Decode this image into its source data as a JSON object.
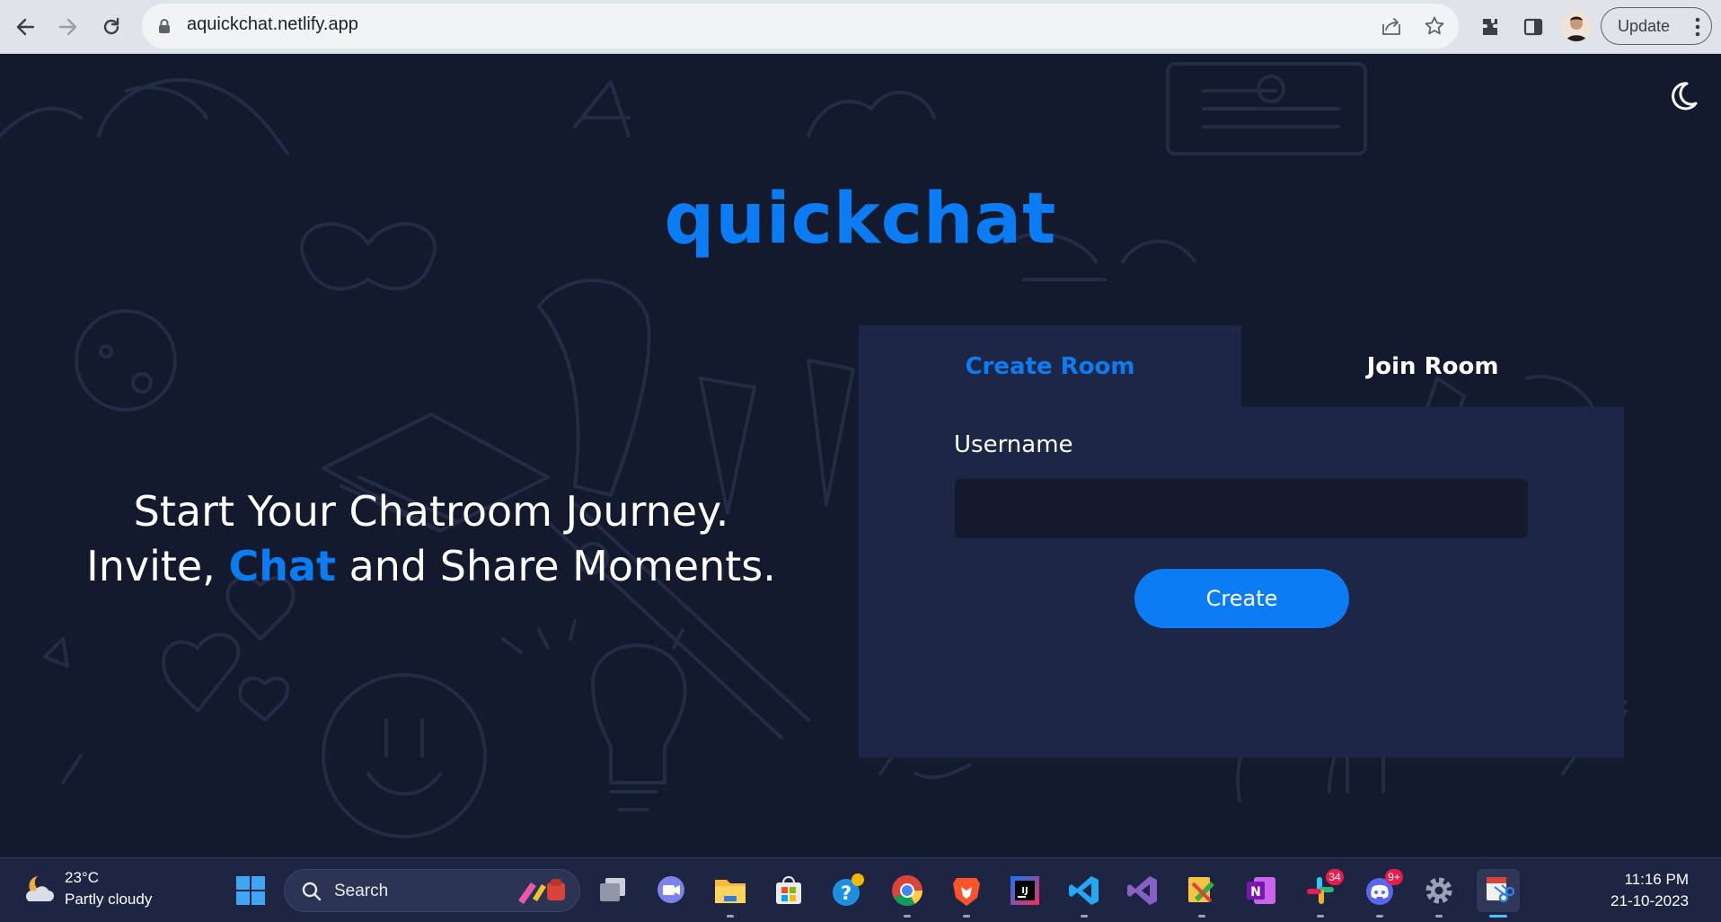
{
  "browser": {
    "url": "aquickchat.netlify.app",
    "update_label": "Update"
  },
  "app": {
    "logo": "quickchat",
    "hero_line1": "Start Your Chatroom Journey.",
    "hero_line2_prefix": "Invite, ",
    "hero_line2_accent": "Chat",
    "hero_line2_suffix": " and Share Moments.",
    "tabs": [
      "Create Room",
      "Join Room"
    ],
    "active_tab": "Create Room",
    "username_label": "Username",
    "username_value": "",
    "create_button": "Create",
    "theme_icon": "moon-icon",
    "accent_color": "#0b7cf3",
    "background_color": "#131a2e",
    "panel_color": "#1d2745"
  },
  "taskbar": {
    "weather_temp": "23°C",
    "weather_condition": "Partly cloudy",
    "search_placeholder": "Search",
    "badges": {
      "slack": "34",
      "discord": "9+"
    },
    "time": "11:16 PM",
    "date": "21-10-2023",
    "apps": [
      "windows-start",
      "task-view",
      "teams",
      "file-explorer",
      "microsoft-store",
      "get-help",
      "chrome",
      "brave",
      "intellij",
      "vs-code",
      "visual-studio",
      "snipping",
      "onenote",
      "slack",
      "discord",
      "settings",
      "snipping-tool"
    ]
  }
}
